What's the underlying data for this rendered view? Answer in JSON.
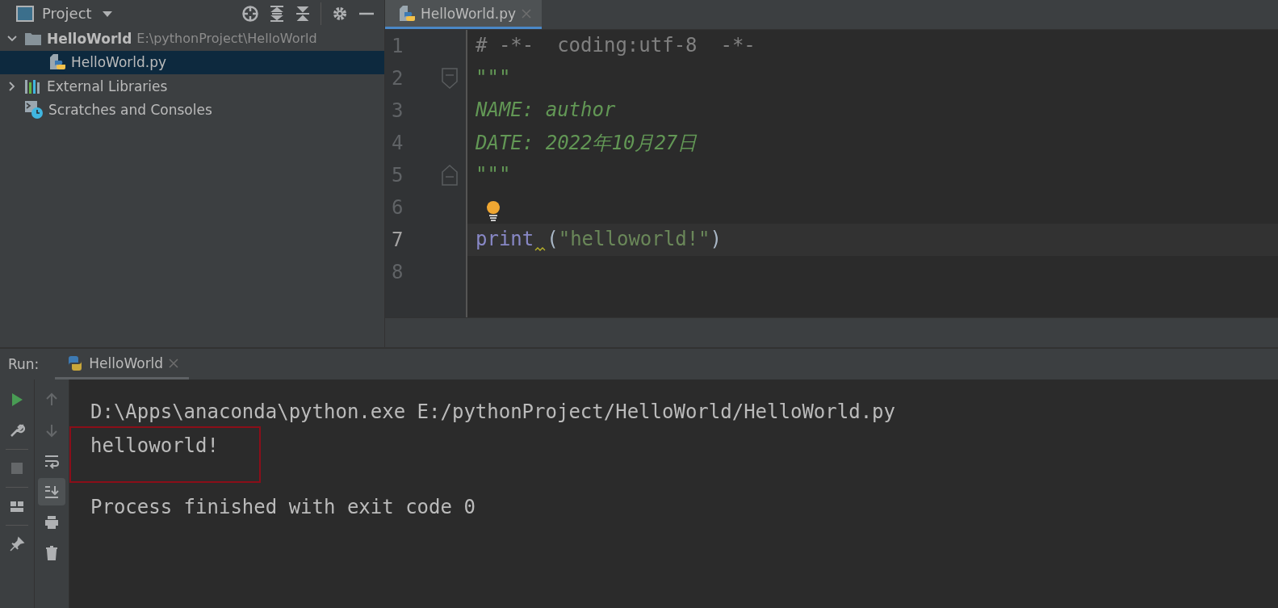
{
  "project_panel": {
    "title": "Project",
    "tree": [
      {
        "label": "HelloWorld",
        "path": "E:\\pythonProject\\HelloWorld",
        "kind": "folder",
        "expanded": true,
        "selected": false,
        "children": [
          {
            "label": "HelloWorld.py",
            "kind": "python-file",
            "selected": true
          }
        ]
      },
      {
        "label": "External Libraries",
        "kind": "libraries",
        "expanded": false,
        "selected": false
      },
      {
        "label": "Scratches and Consoles",
        "kind": "scratches",
        "selected": false
      }
    ]
  },
  "editor": {
    "tabs": [
      {
        "label": "HelloWorld.py",
        "selected": true
      }
    ],
    "lines": [
      {
        "number": "1",
        "kind": "plain",
        "current": false,
        "lightbulb": false,
        "warning": false,
        "tokens": [
          {
            "kind": "comment",
            "text": "# -*-  coding:utf-8  -*-"
          }
        ]
      },
      {
        "number": "2",
        "kind": "fold-start",
        "current": false,
        "lightbulb": false,
        "warning": false,
        "tokens": [
          {
            "kind": "docstring",
            "text": "\"\"\""
          }
        ]
      },
      {
        "number": "3",
        "kind": "plain",
        "current": false,
        "lightbulb": false,
        "warning": false,
        "tokens": [
          {
            "kind": "docstring",
            "text": "NAME: author"
          }
        ]
      },
      {
        "number": "4",
        "kind": "plain",
        "current": false,
        "lightbulb": false,
        "warning": false,
        "tokens": [
          {
            "kind": "docstring",
            "text": "DATE: 2022年10月27日"
          }
        ]
      },
      {
        "number": "5",
        "kind": "fold-end",
        "current": false,
        "lightbulb": false,
        "warning": false,
        "tokens": [
          {
            "kind": "docstring",
            "text": "\"\"\""
          }
        ]
      },
      {
        "number": "6",
        "kind": "plain",
        "current": false,
        "lightbulb": true,
        "warning": false
      },
      {
        "number": "7",
        "kind": "plain",
        "current": true,
        "lightbulb": false,
        "warning": true,
        "tokens": [
          {
            "kind": "builtin",
            "text": "print"
          },
          {
            "kind": "plain",
            "text": "("
          },
          {
            "kind": "string",
            "text": "\"helloworld!\""
          },
          {
            "kind": "plain",
            "text": ")"
          }
        ]
      },
      {
        "number": "8",
        "kind": "plain",
        "current": false,
        "lightbulb": false,
        "warning": false
      }
    ]
  },
  "run_panel": {
    "title": "Run:",
    "tabs": [
      {
        "label": "HelloWorld",
        "selected": true
      }
    ],
    "toolbar": [
      {
        "kind": "run",
        "disabled": false,
        "on": false
      },
      {
        "kind": "up",
        "disabled": true,
        "on": false
      },
      {
        "kind": "wrench",
        "disabled": false,
        "on": false
      },
      {
        "kind": "down",
        "disabled": true,
        "on": false
      },
      {
        "kind": "stop",
        "disabled": true,
        "on": false
      },
      {
        "kind": "wrap",
        "disabled": false,
        "on": false
      },
      {
        "kind": "layout",
        "disabled": false,
        "on": false
      },
      {
        "kind": "scroll-end",
        "disabled": false,
        "on": true
      },
      {
        "kind": "pin",
        "disabled": false,
        "on": false
      },
      {
        "kind": "print",
        "disabled": false,
        "on": false
      },
      {
        "kind": "trash",
        "disabled": false,
        "on": false
      }
    ],
    "console": [
      {
        "kind": "command",
        "text": "D:\\Apps\\anaconda\\python.exe E:/pythonProject/HelloWorld/HelloWorld.py",
        "boxed": false
      },
      {
        "kind": "output",
        "text": "helloworld!",
        "boxed": true
      },
      {
        "kind": "exit",
        "text": "Process finished with exit code 0",
        "boxed": false
      }
    ]
  }
}
